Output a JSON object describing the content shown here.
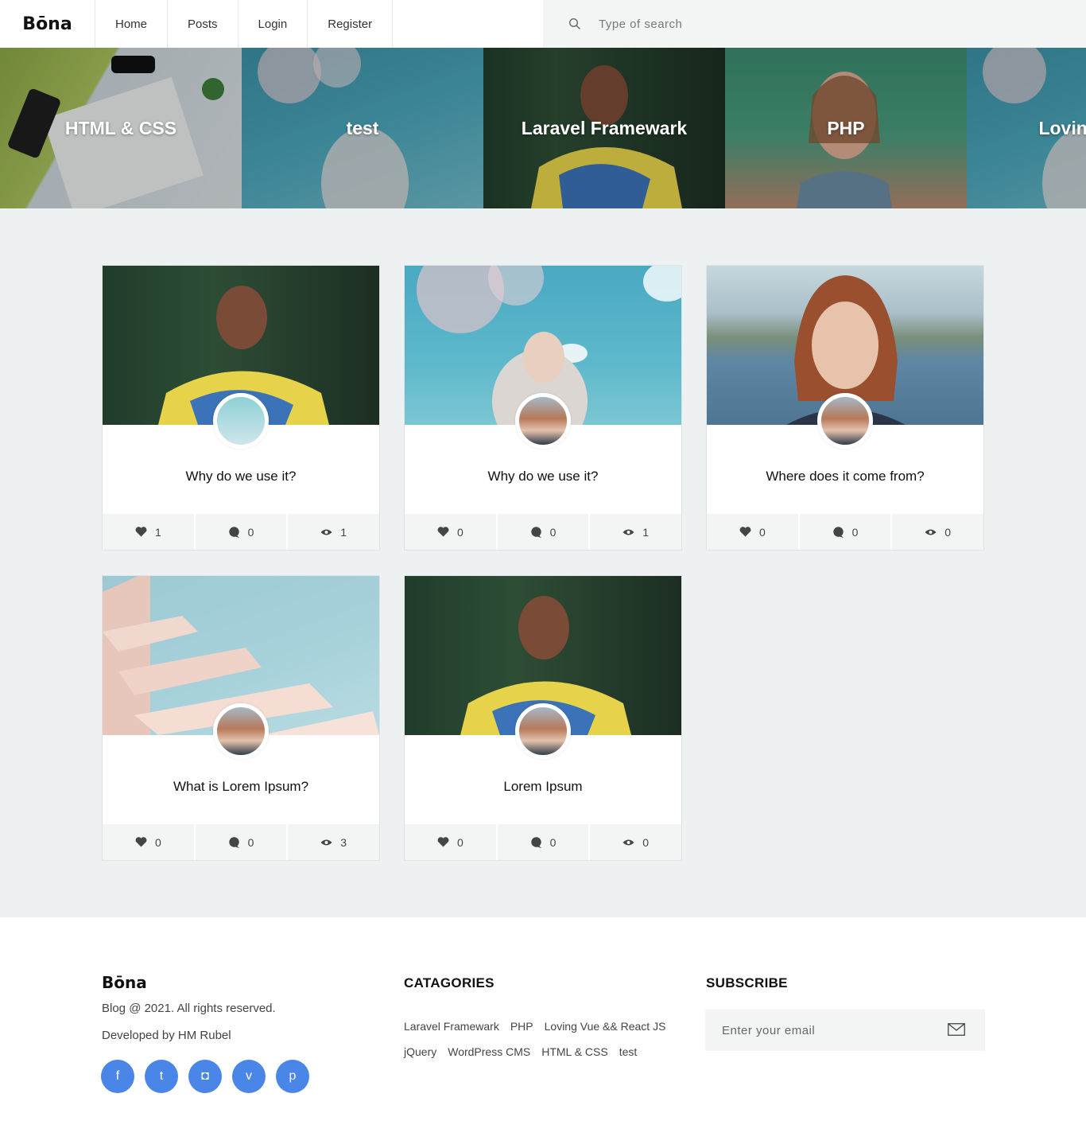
{
  "header": {
    "logo": "Bōna",
    "nav": [
      {
        "label": "Home"
      },
      {
        "label": "Posts"
      },
      {
        "label": "Login"
      },
      {
        "label": "Register"
      }
    ],
    "search_placeholder": "Type of search"
  },
  "slider": [
    {
      "label": "HTML & CSS"
    },
    {
      "label": "test"
    },
    {
      "label": "Laravel Framewark"
    },
    {
      "label": "PHP"
    },
    {
      "label": "Loving Vue"
    }
  ],
  "posts": [
    {
      "title": "Why do we use it?",
      "likes": "1",
      "comments": "0",
      "views": "1"
    },
    {
      "title": "Why do we use it?",
      "likes": "0",
      "comments": "0",
      "views": "1"
    },
    {
      "title": "Where does it come from?",
      "likes": "0",
      "comments": "0",
      "views": "0"
    },
    {
      "title": "What is Lorem Ipsum?",
      "likes": "0",
      "comments": "0",
      "views": "3"
    },
    {
      "title": "Lorem Ipsum",
      "likes": "0",
      "comments": "0",
      "views": "0"
    }
  ],
  "footer": {
    "logo": "Bōna",
    "copyright": "Blog @ 2021. All rights reserved.",
    "developer": "Developed by HM Rubel",
    "socials": [
      {
        "icon": "facebook-icon",
        "glyph": "f"
      },
      {
        "icon": "twitter-icon",
        "glyph": "t"
      },
      {
        "icon": "instagram-icon",
        "glyph": "◘"
      },
      {
        "icon": "vimeo-icon",
        "glyph": "v"
      },
      {
        "icon": "pinterest-icon",
        "glyph": "p"
      }
    ],
    "categories_title": "CATAGORIES",
    "categories": [
      "Laravel Framewark",
      "PHP",
      "Loving Vue && React JS",
      "jQuery",
      "WordPress CMS",
      "HTML & CSS",
      "test"
    ],
    "subscribe_title": "SUBSCRIBE",
    "subscribe_placeholder": "Enter your email"
  },
  "colors": {
    "accent": "#4a86e8",
    "page_bg": "#edf1f1",
    "stats_bg": "#f3f5f5"
  }
}
